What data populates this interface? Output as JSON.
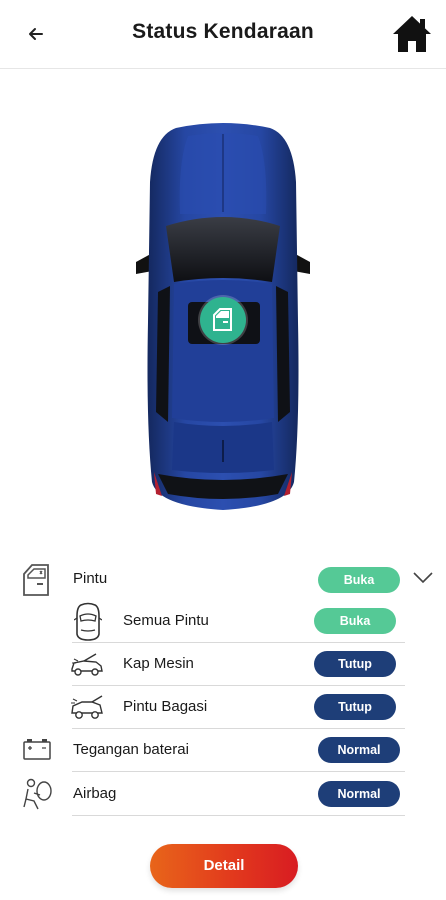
{
  "header": {
    "title": "Status Kendaraan",
    "back_icon": "arrow-left-icon",
    "home_icon": "home-icon"
  },
  "vehicle": {
    "image": "car-top-view",
    "body_color": "#1f3f8c",
    "door_status_icon": "car-door-icon"
  },
  "status": {
    "pintu": {
      "label": "Pintu",
      "value": "Buka"
    },
    "semua_pintu": {
      "label": "Semua Pintu",
      "value": "Buka"
    },
    "kap_mesin": {
      "label": "Kap Mesin",
      "value": "Tutup"
    },
    "pintu_bagasi": {
      "label": "Pintu Bagasi",
      "value": "Tutup"
    },
    "tegangan_baterai": {
      "label": "Tegangan baterai",
      "value": "Normal"
    },
    "airbag": {
      "label": "Airbag",
      "value": "Normal"
    }
  },
  "actions": {
    "detail_label": "Detail"
  },
  "colors": {
    "open": "#55c996",
    "closed": "#1e3e78",
    "accent_gradient_start": "#e8651a",
    "accent_gradient_end": "#d81c22"
  }
}
